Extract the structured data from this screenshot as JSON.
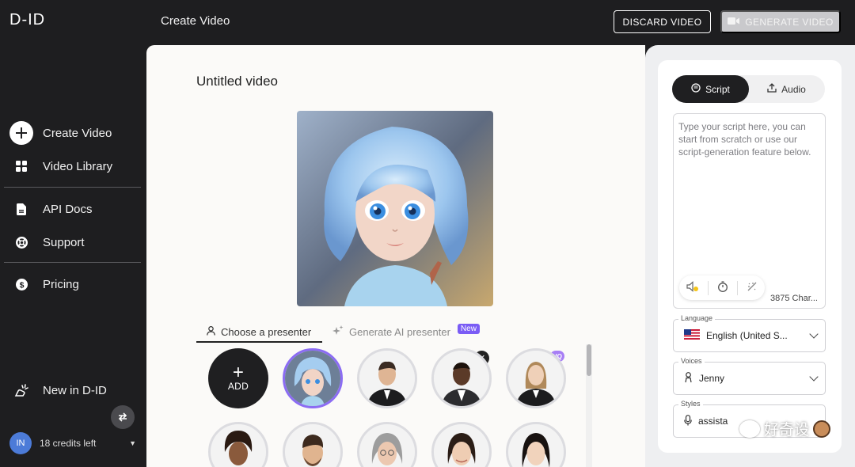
{
  "app": {
    "logo": "D-ID",
    "page_heading": "Create Video"
  },
  "header": {
    "discard_label": "DISCARD VIDEO",
    "generate_label": "GENERATE VIDEO"
  },
  "sidebar": {
    "items": [
      {
        "label": "Create Video",
        "icon": "plus-circle-icon"
      },
      {
        "label": "Video Library",
        "icon": "grid-icon"
      },
      {
        "label": "API Docs",
        "icon": "document-icon"
      },
      {
        "label": "Support",
        "icon": "lifebuoy-icon"
      },
      {
        "label": "Pricing",
        "icon": "dollar-icon"
      },
      {
        "label": "New in D-ID",
        "icon": "sparkle-hand-icon"
      }
    ],
    "user": {
      "initials": "IN",
      "credits": "18 credits left"
    }
  },
  "main": {
    "video_title": "Untitled video",
    "tabs": {
      "choose": "Choose a presenter",
      "generate_ai": "Generate AI presenter",
      "new_badge": "New"
    },
    "add_label": "ADD",
    "hq_label": "HQ"
  },
  "panel": {
    "script_tab": "Script",
    "audio_tab": "Audio",
    "script_placeholder": "Type your script here, you can start from scratch or use our script-generation feature below.",
    "char_count": "3875 Char...",
    "language_label": "Language",
    "language_value": "English (United S...",
    "voices_label": "Voices",
    "voice_value": "Jenny",
    "styles_label": "Styles",
    "style_value": "assista"
  },
  "colors": {
    "accent": "#8b6cf3",
    "badge": "#7a5cf5",
    "dark": "#1e1e20"
  },
  "watermark": {
    "text": "好奇设"
  }
}
